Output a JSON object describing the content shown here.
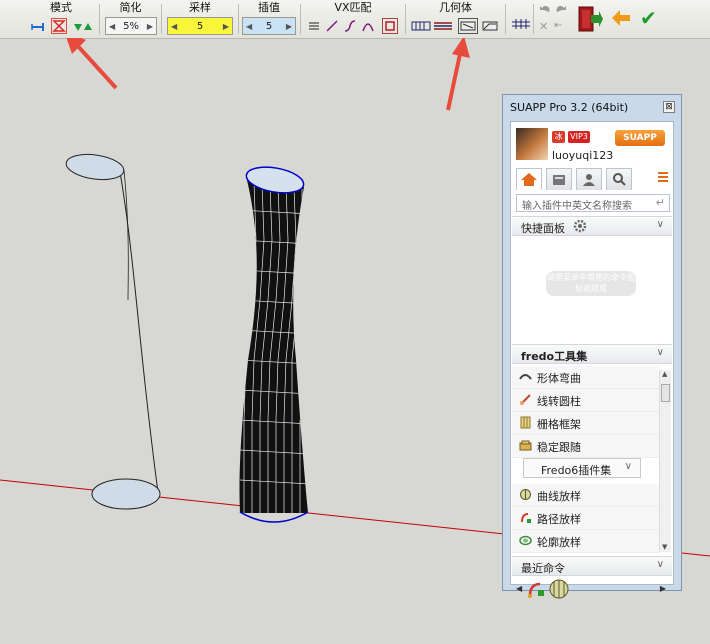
{
  "toolbar": {
    "groups": {
      "mode": "模式",
      "simplify": "简化",
      "sample": "采样",
      "interpolate": "插值",
      "vx_match": "VX匹配",
      "geometry": "几何体"
    },
    "simplify_value": "5%",
    "sample_value": "5",
    "interpolate_value": "5"
  },
  "panel": {
    "title": "SUAPP Pro 3.2 (64bit)",
    "close": "⊠",
    "brand": "SUAPP 3.2",
    "vip_badge": "VIP3",
    "ice_badge": "冰",
    "username": "luoyuqi123",
    "search_placeholder": "输入插件中英文名称搜索",
    "quick_panel": "快捷面板",
    "quick_hint": "调用菜单中常用的命令图标就组成",
    "fredo_section": "fredo工具集",
    "items": [
      {
        "icon": "shape-bend-icon",
        "label": "形体弯曲"
      },
      {
        "icon": "line-to-tube-icon",
        "label": "线转圆柱"
      },
      {
        "icon": "grid-frame-icon",
        "label": "栅格框架"
      },
      {
        "icon": "stable-follow-icon",
        "label": "稳定跟随"
      }
    ],
    "fredo6_label": "Fredo6插件集",
    "items2": [
      {
        "icon": "curve-loft-icon",
        "label": "曲线放样"
      },
      {
        "icon": "path-loft-icon",
        "label": "路径放样"
      },
      {
        "icon": "profile-loft-icon",
        "label": "轮廓放样"
      }
    ],
    "recent_section": "最近命令"
  },
  "colors": {
    "canvas": "#d7d8d3",
    "panel_bg": "#c9d9ea",
    "accent_orange": "#e46f12",
    "arrow_red": "#e64b3c",
    "axis_red": "#c40000",
    "edge_blue": "#0000c8"
  }
}
